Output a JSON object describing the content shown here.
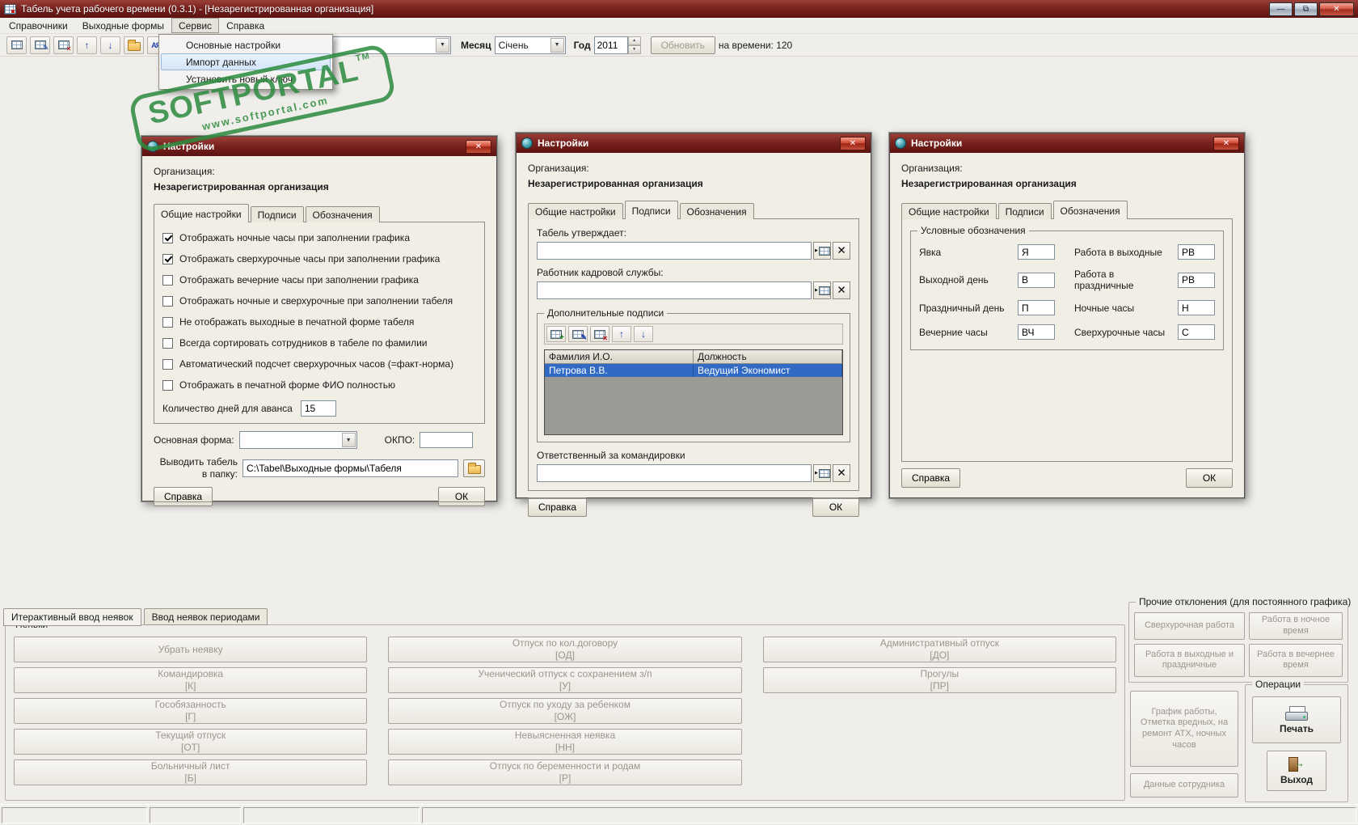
{
  "window": {
    "title": "Табель учета рабочего времени (0.3.1)  - [Незарегистрированная организация]"
  },
  "icons": {
    "minimize": "—",
    "restore": "⧉",
    "close": "✕",
    "combo_arrow": "▼",
    "spin_up": "▲",
    "spin_down": "▼",
    "up_arrow": "↑",
    "down_arrow": "↓",
    "sort_az": "АЯ↓",
    "tariff_t": "Т",
    "lookup_tri": "‣",
    "clear_x": "✕",
    "exit_arrow": "→"
  },
  "menubar": {
    "items": [
      {
        "label": "Справочники"
      },
      {
        "label": "Выходные формы"
      },
      {
        "label": "Сервис"
      },
      {
        "label": "Справка"
      }
    ]
  },
  "service_menu": {
    "items": [
      {
        "label": "Основные настройки"
      },
      {
        "label": "Импорт данных"
      },
      {
        "label": "Установить новый ключ"
      }
    ]
  },
  "toolbar": {
    "filter_value": "",
    "month_label": "Месяц",
    "month_value": "Січень",
    "year_label": "Год",
    "year_value": "2011",
    "refresh_label": "Обновить",
    "status_text": "на времени: 120"
  },
  "watermark": {
    "name": "SOFTPORTAL",
    "tm": "TM",
    "url": "www.softportal.com"
  },
  "dialog_common": {
    "title": "Настройки",
    "org_label": "Организация:",
    "org_name": "Незарегистрированная организация",
    "tabs": [
      "Общие настройки",
      "Подписи",
      "Обозначения"
    ],
    "help": "Справка",
    "ok": "ОК"
  },
  "general_dialog": {
    "checkboxes": [
      {
        "label": "Отображать ночные часы при заполнении графика",
        "checked": true
      },
      {
        "label": "Отображать сверхурочные часы при заполнении графика",
        "checked": true
      },
      {
        "label": "Отображать вечерние часы при заполнении графика",
        "checked": false
      },
      {
        "label": "Отображать ночные и сверхурочные при заполнении табеля",
        "checked": false
      },
      {
        "label": "Не отображать выходные в печатной форме табеля",
        "checked": false
      },
      {
        "label": "Всегда сортировать сотрудников в табеле по фамилии",
        "checked": false
      },
      {
        "label": "Автоматический подсчет сверхурочных часов (=факт-норма)",
        "checked": false
      },
      {
        "label": "Отображать в печатной форме ФИО полностью",
        "checked": false
      }
    ],
    "advance_label": "Количество дней для аванса",
    "advance_value": "15",
    "main_form_label": "Основная форма:",
    "main_form_value": "",
    "okpo_label": "ОКПО:",
    "okpo_value": "",
    "output_label": "Выводить табель в папку:",
    "output_value": "C:\\Tabel\\Выходные формы\\Табеля"
  },
  "signs_dialog": {
    "approves_label": "Табель утверждает:",
    "approves_value": "",
    "hr_label": "Работник кадровой службы:",
    "hr_value": "",
    "extra_group": "Дополнительные подписи",
    "table": {
      "headers": [
        "Фамилия И.О.",
        "Должность"
      ],
      "rows": [
        {
          "name": "Петрова В.В.",
          "position": "Ведущий Экономист"
        }
      ]
    },
    "trips_label": "Ответственный за командировки",
    "trips_value": ""
  },
  "legend_dialog": {
    "group": "Условные обозначения",
    "left": [
      {
        "label": "Явка",
        "value": "Я"
      },
      {
        "label": "Выходной день",
        "value": "В"
      },
      {
        "label": "Праздничный день",
        "value": "П"
      },
      {
        "label": "Вечерние часы",
        "value": "ВЧ"
      }
    ],
    "right": [
      {
        "label": "Работа в выходные",
        "value": "РВ"
      },
      {
        "label": "Работа в праздничные",
        "value": "РВ"
      },
      {
        "label": "Ночные часы",
        "value": "Н"
      },
      {
        "label": "Сверхурочные часы",
        "value": "С"
      }
    ]
  },
  "bottom": {
    "tabs": [
      {
        "label": "Итерактивный ввод неявок"
      },
      {
        "label": "Ввод неявок периодами"
      }
    ],
    "absence_group": "Неявки",
    "col1": [
      {
        "text": "Убрать неявку",
        "code": ""
      },
      {
        "text": "Командировка",
        "code": "[К]"
      },
      {
        "text": "Гособязанность",
        "code": "[Г]"
      },
      {
        "text": "Текущий отпуск",
        "code": "[ОТ]"
      },
      {
        "text": "Больничный лист",
        "code": "[Б]"
      }
    ],
    "col2": [
      {
        "text": "Отпуск по кол.договору",
        "code": "[ОД]"
      },
      {
        "text": "Ученический отпуск с сохранением з/п",
        "code": "[У]"
      },
      {
        "text": "Отпуск по уходу за ребенком",
        "code": "[ОЖ]"
      },
      {
        "text": "Невыясненная неявка",
        "code": "[НН]"
      },
      {
        "text": "Отпуск по беременности и родам",
        "code": "[Р]"
      }
    ],
    "col3": [
      {
        "text": "Административный отпуск",
        "code": "[ДО]"
      },
      {
        "text": "Прогулы",
        "code": "[ПР]"
      }
    ],
    "other_group": "Прочие отклонения (для постоянного графика)",
    "other_buttons": [
      {
        "text": "Сверхурочная работа"
      },
      {
        "text": "Работа в ночное время"
      },
      {
        "text": "Работа в выходные и праздничные"
      },
      {
        "text": "Работа в вечернее время"
      }
    ],
    "schedule_button": "График работы, Отметка вредных, на ремонт АТХ, ночных часов",
    "employee_button": "Данные сотрудника",
    "operations_group": "Операции",
    "print_button": "Печать",
    "exit_button": "Выход"
  }
}
